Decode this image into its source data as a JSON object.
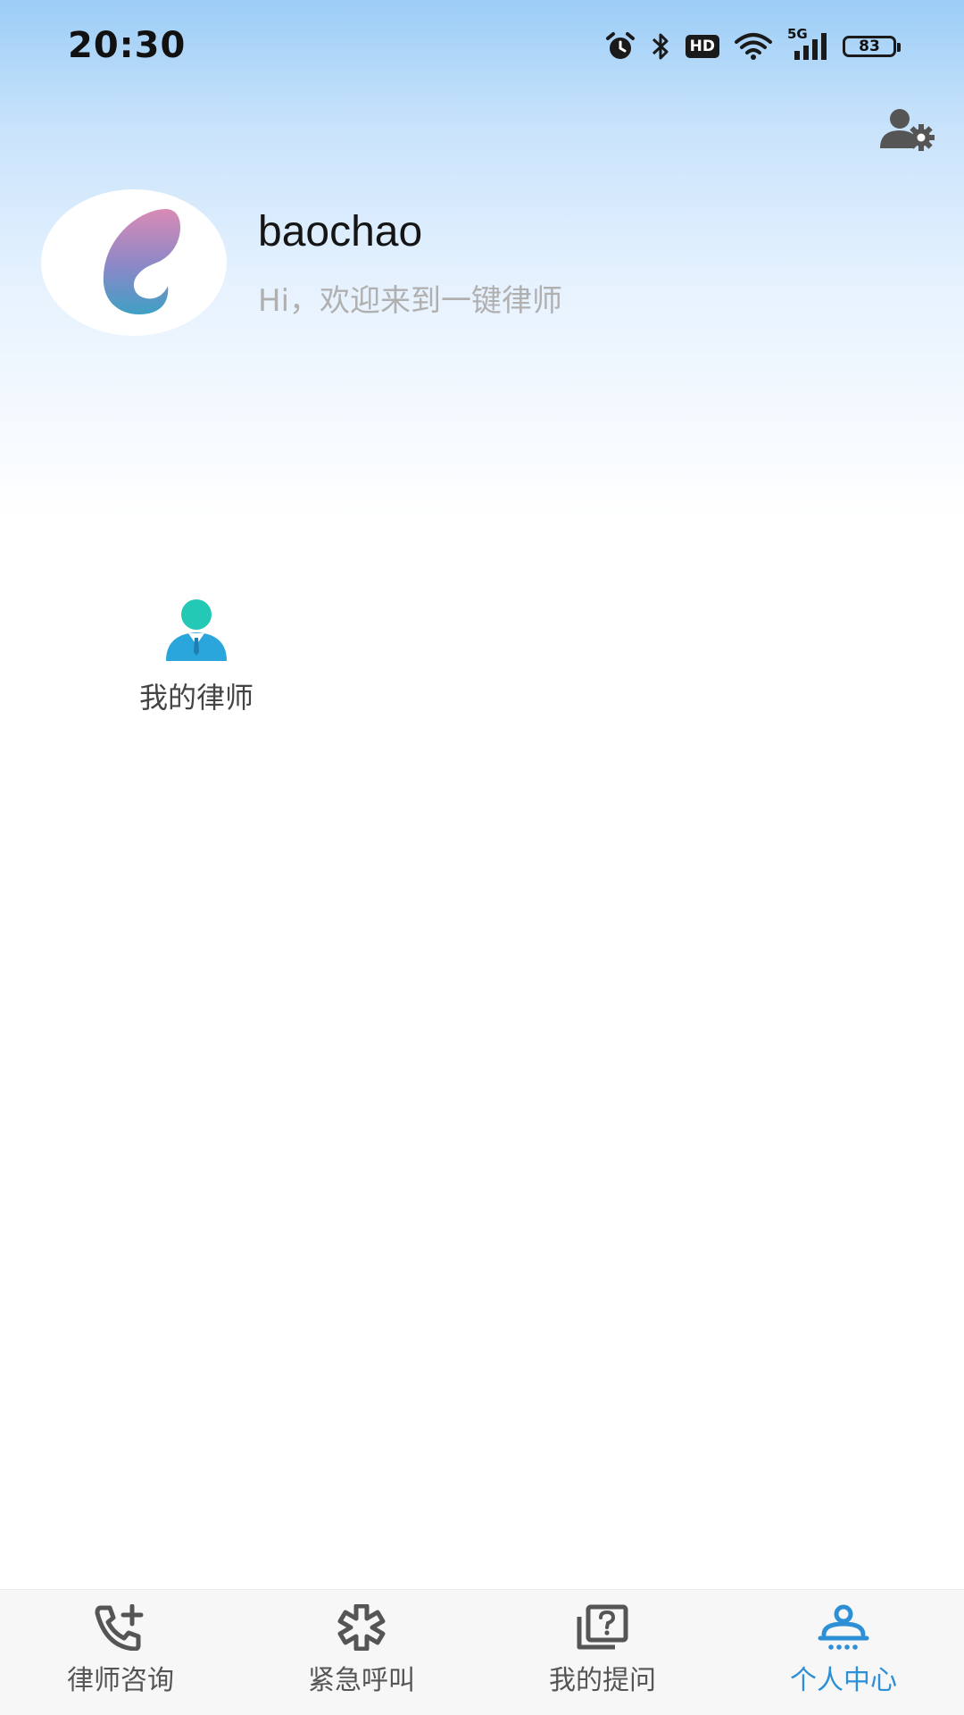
{
  "status_bar": {
    "time": "20:30",
    "hd_label": "HD",
    "network_label": "5G",
    "battery": "83"
  },
  "profile": {
    "username": "baochao",
    "welcome": "Hi，欢迎来到一键律师"
  },
  "menu": {
    "items": [
      {
        "label": "我的律师",
        "icon": "lawyer-icon"
      }
    ]
  },
  "bottom_nav": {
    "items": [
      {
        "label": "律师咨询",
        "icon": "phone-plus-icon",
        "active": false
      },
      {
        "label": "紧急呼叫",
        "icon": "asterisk-icon",
        "active": false
      },
      {
        "label": "我的提问",
        "icon": "question-box-icon",
        "active": false
      },
      {
        "label": "个人中心",
        "icon": "user-icon",
        "active": true
      }
    ]
  },
  "colors": {
    "accent": "#2d8fd6",
    "header_gradient_top": "#9ccdf6",
    "inactive_icon": "#555555",
    "lawyer_head": "#23c9b5",
    "lawyer_body": "#2aa6dc"
  }
}
